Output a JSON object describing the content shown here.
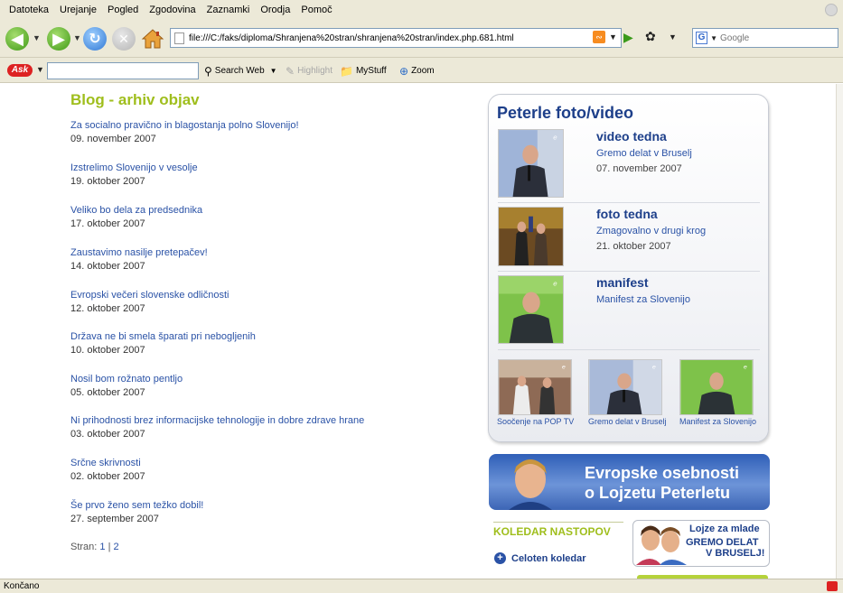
{
  "menu": [
    "Datoteka",
    "Urejanje",
    "Pogled",
    "Zgodovina",
    "Zaznamki",
    "Orodja",
    "Pomoč"
  ],
  "address": {
    "url": "file:///C:/faks/diploma/Shranjena%20stran/shranjena%20stran/index.php.681.html"
  },
  "search": {
    "placeholder": "Google",
    "engine_icon": "google-icon"
  },
  "askbar": {
    "search_web": "Search Web",
    "highlight": "Highlight",
    "mystuff": "MyStuff",
    "zoom": "Zoom"
  },
  "blog": {
    "title": "Blog - arhiv objav",
    "posts": [
      {
        "title": "Za socialno pravično in blagostanja polno Slovenijo!",
        "date": "09. november 2007"
      },
      {
        "title": "Izstrelimo Slovenijo v vesolje",
        "date": "19. oktober 2007"
      },
      {
        "title": "Veliko bo dela za predsednika",
        "date": "17. oktober 2007"
      },
      {
        "title": "Zaustavimo nasilje pretepačev!",
        "date": "14. oktober 2007"
      },
      {
        "title": "Evropski večeri slovenske odličnosti",
        "date": "12. oktober 2007"
      },
      {
        "title": "Država ne bi smela šparati pri nebogljenih",
        "date": "10. oktober 2007"
      },
      {
        "title": "Nosil bom rožnato pentljo",
        "date": "05. oktober 2007"
      },
      {
        "title": "Ni prihodnosti brez informacijske tehnologije in dobre zdrave hrane",
        "date": "03. oktober 2007"
      },
      {
        "title": "Srčne skrivnosti",
        "date": "02. oktober 2007"
      },
      {
        "title": "Še prvo ženo sem težko dobil!",
        "date": "27. september 2007"
      }
    ],
    "pager": {
      "label": "Stran:",
      "page1": "1",
      "sep": "|",
      "page2": "2"
    }
  },
  "photo": {
    "heading": "Peterle foto/video",
    "items": [
      {
        "head": "video tedna",
        "sub": "Gremo delat v Bruselj",
        "date": "07. november 2007"
      },
      {
        "head": "foto tedna",
        "sub": "Zmagovalno v drugi krog",
        "date": "21. oktober 2007"
      },
      {
        "head": "manifest",
        "sub": "Manifest za Slovenijo",
        "date": ""
      }
    ],
    "small": [
      {
        "caption": "Soočenje na POP TV"
      },
      {
        "caption": "Gremo delat v Bruselj"
      },
      {
        "caption": "Manifest za Slovenijo"
      }
    ]
  },
  "banner": {
    "line1": "Evropske osebnosti",
    "line2": "o Lojzetu Peterletu"
  },
  "koledar": {
    "title": "KOLEDAR NASTOPOV",
    "link": "Celoten koledar"
  },
  "mlade": {
    "line1": "Lojze za mlade",
    "line2": "GREMO DELAT",
    "line3": "V BRUSELJ!"
  },
  "status": {
    "text": "Končano"
  }
}
